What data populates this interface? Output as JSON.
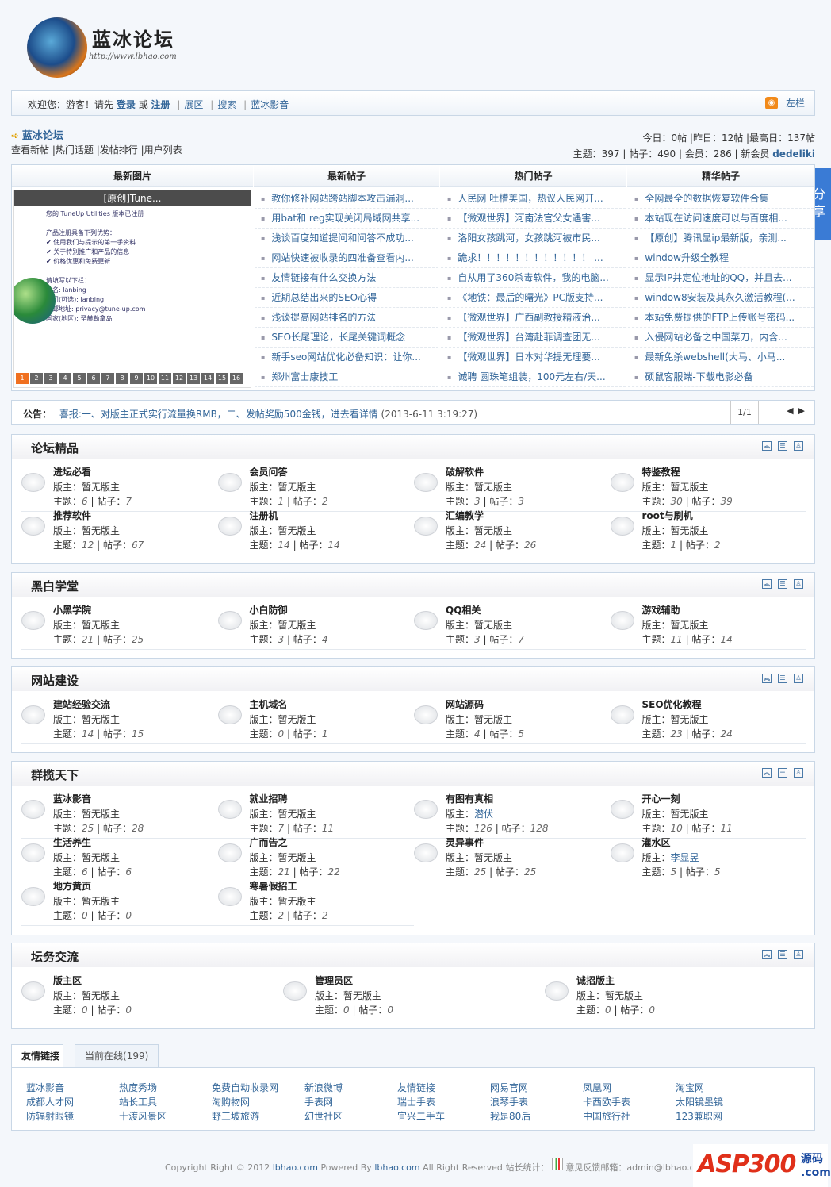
{
  "logo": {
    "title": "蓝冰论坛",
    "url": "http://www.lbhao.com"
  },
  "topbar": {
    "welcome": "欢迎您：游客！请先",
    "login": "登录",
    "or": "或",
    "register": "注册",
    "links": [
      "展区",
      "搜索",
      "蓝冰影音"
    ],
    "left_toggle": "左栏"
  },
  "breadcrumb": "蓝冰论坛",
  "nav": [
    "查看新帖",
    "热门话题",
    "发帖排行",
    "用户列表"
  ],
  "stats": {
    "line1": "今日：0帖 |昨日：12帖 |最高日：137帖",
    "line2": "主题：397 | 帖子：490 | 会员：286 | 新会员",
    "newest_member": "dedeliki"
  },
  "share": "分享",
  "latest": {
    "headers": [
      "最新图片",
      "最新帖子",
      "热门帖子",
      "精华帖子"
    ],
    "picture": {
      "caption": "[原创]Tune...",
      "lines": [
        "您的 TuneUp Utilities 版本已注册",
        "",
        "产品注册具备下列优势：",
        "✔ 使用我们与提示的第一手资料",
        "✔ 关于特别推广和产品的信息",
        "✔ 价格优惠和免费更新",
        "",
        "请填写以下栏：",
        "姓名:  lanbing",
        "公司(可选):  lanbing",
        "电邮地址:  privacy@tune-up.com",
        "国家(地区):  圣赫勒拿岛"
      ],
      "pages": [
        "1",
        "2",
        "3",
        "4",
        "5",
        "6",
        "7",
        "8",
        "9",
        "10",
        "11",
        "12",
        "13",
        "14",
        "15",
        "16"
      ],
      "active_page": "1"
    },
    "newest": [
      "教你修补网站跨站脚本攻击漏洞...",
      "用bat和 reg实现关闭局域网共享...",
      "浅谈百度知道提问和问答不成功...",
      "网站快速被收录的四准备查看内...",
      "友情链接有什么交换方法",
      "近期总结出来的SEO心得",
      "浅谈提高网站排名的方法",
      "SEO长尾理论，长尾关键词概念",
      "新手seo网站优化必备知识：让你...",
      "郑州富士康技工"
    ],
    "hot": [
      "人民网 吐槽美国，热议人民网开...",
      "【微观世界】河南法官父女遇害...",
      "洛阳女孩跳河，女孩跳河被市民...",
      "跪求！！！！！！！！！！！！ ...",
      "自从用了360杀毒软件，我的电脑...",
      "《地铁：最后的曙光》PC版支持...",
      "【微观世界】广西副教授精液治...",
      "【微观世界】台湾赴菲调查团无...",
      "【微观世界】日本对华提无理要...",
      "诚聘 圆珠笔组装，100元左右/天..."
    ],
    "elite": [
      "全网最全的数据恢复软件合集",
      "本站现在访问速度可以与百度相...",
      "【原创】腾讯显ip最新版，亲测...",
      "window升级全教程",
      "显示IP并定位地址的QQ，并且去...",
      "window8安装及其永久激活教程(...",
      "本站免费提供的FTP上传账号密码...",
      "入侵网站必备之中国菜刀，内含...",
      "最新免杀webshell(大马、小马...",
      "硕鼠客服端-下载电影必备"
    ]
  },
  "notice": {
    "label": "公告：",
    "text": "喜报:一、对版主正式实行流量换RMB，二、发帖奖励500金钱，进去看详情",
    "time": "(2013-6-11 3:19:27)",
    "page": "1/1"
  },
  "labels": {
    "mod": "版主：",
    "topics": "主题：",
    "posts": "帖子："
  },
  "categories": [
    {
      "title": "论坛精品",
      "forums": [
        {
          "name": "进坛必看",
          "mod": "暂无版主",
          "topics": "6",
          "posts": "7"
        },
        {
          "name": "会员问答",
          "mod": "暂无版主",
          "topics": "1",
          "posts": "2"
        },
        {
          "name": "破解软件",
          "mod": "暂无版主",
          "topics": "3",
          "posts": "3"
        },
        {
          "name": "特鉴教程",
          "mod": "暂无版主",
          "topics": "30",
          "posts": "39"
        },
        {
          "name": "推荐软件",
          "mod": "暂无版主",
          "topics": "12",
          "posts": "67"
        },
        {
          "name": "注册机",
          "mod": "暂无版主",
          "topics": "14",
          "posts": "14"
        },
        {
          "name": "汇编教学",
          "mod": "暂无版主",
          "topics": "24",
          "posts": "26"
        },
        {
          "name": "root与刷机",
          "mod": "暂无版主",
          "topics": "1",
          "posts": "2"
        }
      ]
    },
    {
      "title": "黑白学堂",
      "forums": [
        {
          "name": "小黑学院",
          "mod": "暂无版主",
          "topics": "21",
          "posts": "25"
        },
        {
          "name": "小白防御",
          "mod": "暂无版主",
          "topics": "3",
          "posts": "4"
        },
        {
          "name": "QQ相关",
          "mod": "暂无版主",
          "topics": "3",
          "posts": "7"
        },
        {
          "name": "游戏辅助",
          "mod": "暂无版主",
          "topics": "11",
          "posts": "14"
        }
      ]
    },
    {
      "title": "网站建设",
      "forums": [
        {
          "name": "建站经验交流",
          "mod": "暂无版主",
          "topics": "14",
          "posts": "15"
        },
        {
          "name": "主机域名",
          "mod": "暂无版主",
          "topics": "0",
          "posts": "1"
        },
        {
          "name": "网站源码",
          "mod": "暂无版主",
          "topics": "4",
          "posts": "5"
        },
        {
          "name": "SEO优化教程",
          "mod": "暂无版主",
          "topics": "23",
          "posts": "24"
        }
      ]
    },
    {
      "title": "群揽天下",
      "forums": [
        {
          "name": "蓝冰影音",
          "mod": "暂无版主",
          "topics": "25",
          "posts": "28"
        },
        {
          "name": "就业招聘",
          "mod": "暂无版主",
          "topics": "7",
          "posts": "11"
        },
        {
          "name": "有图有真相",
          "mod": "潜伏",
          "mod_link": true,
          "topics": "126",
          "posts": "128"
        },
        {
          "name": "开心一刻",
          "mod": "暂无版主",
          "topics": "10",
          "posts": "11"
        },
        {
          "name": "生活养生",
          "mod": "暂无版主",
          "topics": "6",
          "posts": "6"
        },
        {
          "name": "广而告之",
          "mod": "暂无版主",
          "topics": "21",
          "posts": "22"
        },
        {
          "name": "灵异事件",
          "mod": "暂无版主",
          "topics": "25",
          "posts": "25"
        },
        {
          "name": "灌水区",
          "mod": "李显昱",
          "mod_link": true,
          "topics": "5",
          "posts": "5"
        },
        {
          "name": "地方黄页",
          "mod": "暂无版主",
          "topics": "0",
          "posts": "0"
        },
        {
          "name": "寒暑假招工",
          "mod": "暂无版主",
          "topics": "2",
          "posts": "2"
        }
      ]
    },
    {
      "title": "坛务交流",
      "forums": [
        {
          "name": "版主区",
          "mod": "暂无版主",
          "topics": "0",
          "posts": "0"
        },
        {
          "name": "管理员区",
          "mod": "暂无版主",
          "topics": "0",
          "posts": "0"
        },
        {
          "name": "诚招版主",
          "mod": "暂无版主",
          "topics": "0",
          "posts": "0"
        }
      ]
    }
  ],
  "tabs": [
    "友情链接",
    "当前在线(199)"
  ],
  "links": [
    "蓝冰影音",
    "热度秀场",
    "免费自动收录网",
    "新浪微博",
    "友情链接",
    "网易官网",
    "凤凰网",
    "淘宝网",
    "成都人才网",
    "站长工具",
    "淘购物网",
    "手表网",
    "瑞士手表",
    "浪琴手表",
    "卡西欧手表",
    "太阳镜墨镜",
    "防辐射眼镜",
    "十渡风景区",
    "野三坡旅游",
    "幻世社区",
    "宜兴二手车",
    "我是80后",
    "中国旅行社",
    "123兼职网"
  ],
  "footer": {
    "copyright": "Copyright Right © 2012",
    "site1": "lbhao.com",
    "powered": "Powered By",
    "site2": "lbhao.com",
    "rights": "All Right Reserved 站长统计：",
    "feedback": "意见反馈邮箱：admin@lbhao.com"
  },
  "watermark": {
    "text": "ASP300",
    "sub": "源码 .com"
  }
}
